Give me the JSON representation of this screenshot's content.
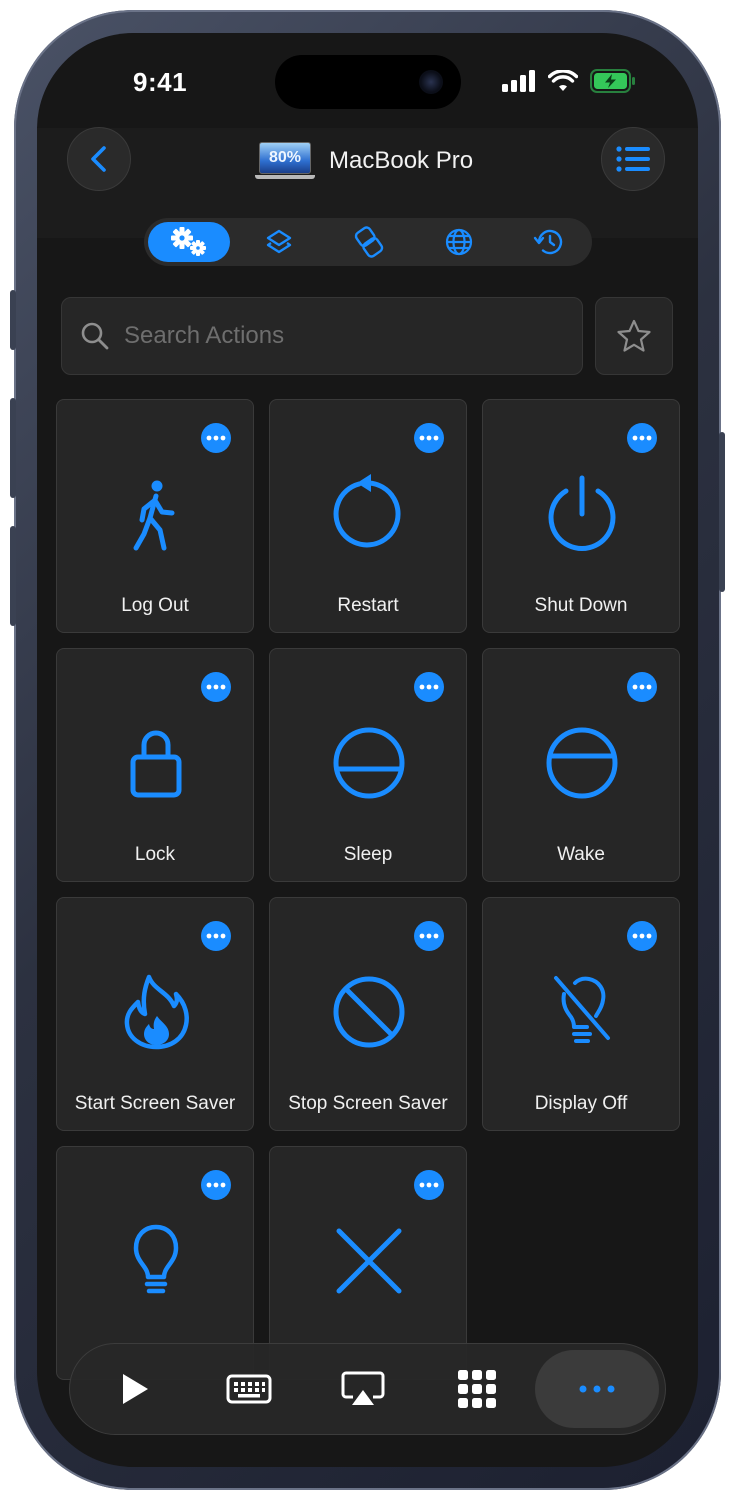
{
  "status_bar": {
    "time": "9:41",
    "battery_state": "charging"
  },
  "nav": {
    "title": "MacBook Pro",
    "device_battery": "80%",
    "back_icon": "chevron-left-icon",
    "menu_icon": "list-icon"
  },
  "tabs": [
    {
      "icon": "gears-icon",
      "active": true
    },
    {
      "icon": "layers-icon",
      "active": false
    },
    {
      "icon": "shortcuts-icon",
      "active": false
    },
    {
      "icon": "globe-icon",
      "active": false
    },
    {
      "icon": "history-icon",
      "active": false
    }
  ],
  "search": {
    "placeholder": "Search Actions"
  },
  "actions": [
    {
      "label": "Log Out",
      "icon": "walking-figure-icon"
    },
    {
      "label": "Restart",
      "icon": "restart-icon"
    },
    {
      "label": "Shut Down",
      "icon": "power-icon"
    },
    {
      "label": "Lock",
      "icon": "lock-icon"
    },
    {
      "label": "Sleep",
      "icon": "sleep-icon"
    },
    {
      "label": "Wake",
      "icon": "wake-icon"
    },
    {
      "label": "Start Screen Saver",
      "icon": "flame-icon"
    },
    {
      "label": "Stop Screen Saver",
      "icon": "prohibited-icon"
    },
    {
      "label": "Display Off",
      "icon": "lightbulb-slash-icon"
    },
    {
      "label": "",
      "icon": "lightbulb-icon"
    },
    {
      "label": "",
      "icon": "close-x-icon"
    }
  ],
  "dock": [
    {
      "icon": "play-icon",
      "active": false
    },
    {
      "icon": "keyboard-icon",
      "active": false
    },
    {
      "icon": "airplay-icon",
      "active": false
    },
    {
      "icon": "grid-icon",
      "active": false
    },
    {
      "icon": "more-icon",
      "active": true
    }
  ],
  "colors": {
    "accent": "#1a8cff",
    "background": "#171717",
    "tile": "#262626",
    "battery_green": "#34c759"
  }
}
